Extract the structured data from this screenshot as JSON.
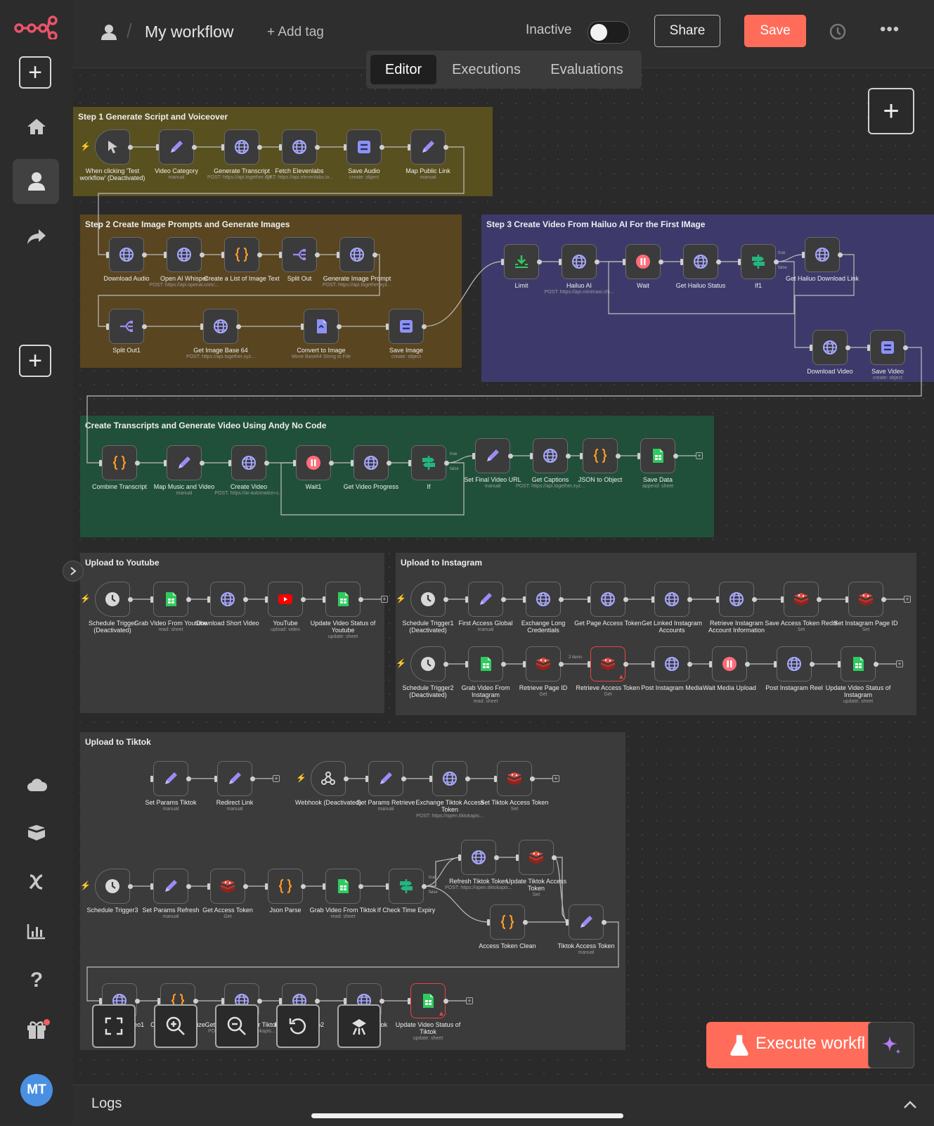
{
  "header": {
    "workflow_name": "My workflow",
    "add_tag_label": "+ Add tag",
    "status_label": "Inactive",
    "share_label": "Share",
    "save_label": "Save"
  },
  "tabs": [
    {
      "label": "Editor",
      "active": true
    },
    {
      "label": "Executions",
      "active": false
    },
    {
      "label": "Evaluations",
      "active": false
    }
  ],
  "sidebar": {
    "user_initials": "MT",
    "icons": [
      "logo-icon",
      "add-icon",
      "home-icon",
      "user-icon",
      "share-icon",
      "add-icon",
      "cloud-icon",
      "templates-icon",
      "variables-icon",
      "insights-icon",
      "help-icon",
      "gift-icon"
    ]
  },
  "stickies": [
    {
      "title": "Step 1 Generate Script and Voiceover"
    },
    {
      "title": "Step 2 Create Image Prompts and Generate Images"
    },
    {
      "title": "Step 3 Create Video From Hailuo AI For the First IMage"
    },
    {
      "title": "Create Transcripts and Generate Video Using Andy No Code"
    },
    {
      "title": "Upload to Youtube"
    },
    {
      "title": "Upload to Instagram"
    },
    {
      "title": "Upload to Tiktok"
    }
  ],
  "nodes": [
    {
      "label": "When clicking 'Test workflow' (Deactivated)",
      "sub": "",
      "icon": "cursor-icon"
    },
    {
      "label": "Video Category",
      "sub": "manual",
      "icon": "pencil-icon"
    },
    {
      "label": "Generate Transcript",
      "sub": "POST: https://api.together.xyz...",
      "icon": "globe-icon"
    },
    {
      "label": "Fetch Elevenlabs",
      "sub": "GET: https://api.elevenlabs.io...",
      "icon": "globe-icon"
    },
    {
      "label": "Save Audio",
      "sub": "create: object",
      "icon": "storage-icon"
    },
    {
      "label": "Map Public Link",
      "sub": "manual",
      "icon": "pencil-icon"
    },
    {
      "label": "Download Audio",
      "sub": "",
      "icon": "globe-icon"
    },
    {
      "label": "Open AI Whisper",
      "sub": "POST: https://api.openai.com/...",
      "icon": "globe-icon"
    },
    {
      "label": "Create a List of Image Text",
      "sub": "",
      "icon": "code-icon"
    },
    {
      "label": "Split Out",
      "sub": "",
      "icon": "split-icon"
    },
    {
      "label": "Generate Image Prompt",
      "sub": "POST: https://api.together.xyz...",
      "icon": "globe-icon"
    },
    {
      "label": "Split Out1",
      "sub": "",
      "icon": "split-icon"
    },
    {
      "label": "Get Image Base 64",
      "sub": "POST: https://api.together.xyz...",
      "icon": "globe-icon"
    },
    {
      "label": "Convert to Image",
      "sub": "Move Base64 String to File",
      "icon": "file-icon"
    },
    {
      "label": "Save Image",
      "sub": "create: object",
      "icon": "storage-icon"
    },
    {
      "label": "Limit",
      "sub": "",
      "icon": "limit-icon"
    },
    {
      "label": "Hailuo AI",
      "sub": "POST: https://api.minimaxi.chi...",
      "icon": "globe-icon"
    },
    {
      "label": "Wait",
      "sub": "",
      "icon": "wait-icon"
    },
    {
      "label": "Get Hailuo Status",
      "sub": "",
      "icon": "globe-icon"
    },
    {
      "label": "If1",
      "sub": "",
      "icon": "if-icon"
    },
    {
      "label": "Get Hailuo Download Link",
      "sub": "",
      "icon": "globe-icon"
    },
    {
      "label": "Download Video",
      "sub": "",
      "icon": "globe-icon"
    },
    {
      "label": "Save Video",
      "sub": "create: object",
      "icon": "storage-icon"
    },
    {
      "label": "Combine Transcript",
      "sub": "",
      "icon": "code-icon"
    },
    {
      "label": "Map Music and Video",
      "sub": "manual",
      "icon": "pencil-icon"
    },
    {
      "label": "Create Video",
      "sub": "POST: https://ai-automation-c...",
      "icon": "globe-icon"
    },
    {
      "label": "Wait1",
      "sub": "",
      "icon": "wait-icon"
    },
    {
      "label": "Get Video Progress",
      "sub": "",
      "icon": "globe-icon"
    },
    {
      "label": "If",
      "sub": "",
      "icon": "if-icon"
    },
    {
      "label": "Set Final Video URL",
      "sub": "manual",
      "icon": "pencil-icon"
    },
    {
      "label": "Get Captions",
      "sub": "POST: https://api.together.xyz...",
      "icon": "globe-icon"
    },
    {
      "label": "JSON to Object",
      "sub": "",
      "icon": "code-icon"
    },
    {
      "label": "Save Data",
      "sub": "append: sheet",
      "icon": "sheets-icon"
    },
    {
      "label": "Schedule Trigger (Deactivated)",
      "sub": "",
      "icon": "clock-icon"
    },
    {
      "label": "Grab Video From Youtube",
      "sub": "read: sheet",
      "icon": "sheets-icon"
    },
    {
      "label": "Download Short Video",
      "sub": "",
      "icon": "globe-icon"
    },
    {
      "label": "YouTube",
      "sub": "upload: video",
      "icon": "youtube-icon"
    },
    {
      "label": "Update Video Status of Youtube",
      "sub": "update: sheet",
      "icon": "sheets-icon"
    },
    {
      "label": "Schedule Trigger1 (Deactivated)",
      "sub": "",
      "icon": "clock-icon"
    },
    {
      "label": "First Access Global",
      "sub": "manual",
      "icon": "pencil-icon"
    },
    {
      "label": "Exchange Long Credentials",
      "sub": "",
      "icon": "globe-icon"
    },
    {
      "label": "Get Page Access Token",
      "sub": "",
      "icon": "globe-icon"
    },
    {
      "label": "Get Linked Instagram Accounts",
      "sub": "",
      "icon": "globe-icon"
    },
    {
      "label": "Retrieve Instagram Account Information",
      "sub": "",
      "icon": "globe-icon"
    },
    {
      "label": "Save Access Token Redis",
      "sub": "Set",
      "icon": "redis-icon"
    },
    {
      "label": "Set Instagram Page ID",
      "sub": "Set",
      "icon": "redis-icon"
    },
    {
      "label": "Schedule Trigger2 (Deactivated)",
      "sub": "",
      "icon": "clock-icon"
    },
    {
      "label": "Grab Video From Instagram",
      "sub": "read: sheet",
      "icon": "sheets-icon"
    },
    {
      "label": "Retrieve Page ID",
      "sub": "Get",
      "icon": "redis-icon"
    },
    {
      "label": "Retrieve Access Token",
      "sub": "Get",
      "icon": "redis-icon"
    },
    {
      "label": "Post Instagram Media",
      "sub": "",
      "icon": "globe-icon"
    },
    {
      "label": "Wait Media Upload",
      "sub": "",
      "icon": "wait-icon"
    },
    {
      "label": "Post Instagram Reel",
      "sub": "",
      "icon": "globe-icon"
    },
    {
      "label": "Update Video Status of Instagram",
      "sub": "update: sheet",
      "icon": "sheets-icon"
    },
    {
      "label": "Set Params Tiktok",
      "sub": "manual",
      "icon": "pencil-icon"
    },
    {
      "label": "Redirect Link",
      "sub": "manual",
      "icon": "pencil-icon"
    },
    {
      "label": "Webhook (Deactivated)",
      "sub": "",
      "icon": "webhook-icon"
    },
    {
      "label": "Set Params Retrieve",
      "sub": "manual",
      "icon": "pencil-icon"
    },
    {
      "label": "Exchange Tiktok Access Token",
      "sub": "POST: https://open.tiktokapis...",
      "icon": "globe-icon"
    },
    {
      "label": "Set Tiktok Access Token",
      "sub": "Set",
      "icon": "redis-icon"
    },
    {
      "label": "Schedule Trigger3",
      "sub": "",
      "icon": "clock-icon"
    },
    {
      "label": "Set Params Refresh",
      "sub": "manual",
      "icon": "pencil-icon"
    },
    {
      "label": "Get Access Token",
      "sub": "Get",
      "icon": "redis-icon"
    },
    {
      "label": "Json Parse",
      "sub": "",
      "icon": "code-icon"
    },
    {
      "label": "Grab Video From Tiktok",
      "sub": "read: sheet",
      "icon": "sheets-icon"
    },
    {
      "label": "If Check Time Expiry",
      "sub": "",
      "icon": "if-icon"
    },
    {
      "label": "Refresh Tiktok Token",
      "sub": "POST: https://open.tiktokapis...",
      "icon": "globe-icon"
    },
    {
      "label": "Update Tiktok Access Token",
      "sub": "Set",
      "icon": "redis-icon"
    },
    {
      "label": "Access Token Clean",
      "sub": "",
      "icon": "code-icon"
    },
    {
      "label": "Tiktok Access Token",
      "sub": "manual",
      "icon": "pencil-icon"
    },
    {
      "label": "Download Video1",
      "sub": "",
      "icon": "globe-icon"
    },
    {
      "label": "Convert Buffer Size",
      "sub": "",
      "icon": "code-icon"
    },
    {
      "label": "Get Upload URL for Tiktok",
      "sub": "POST: https://open.tiktokapis...",
      "icon": "globe-icon"
    },
    {
      "label": "Download Video2",
      "sub": "",
      "icon": "globe-icon"
    },
    {
      "label": "Upload To Tiktok",
      "sub": "",
      "icon": "globe-icon"
    },
    {
      "label": "Update Video Status of Tiktok",
      "sub": "update: sheet",
      "icon": "sheets-icon"
    }
  ],
  "edge_labels": {
    "true": "true",
    "false": "false",
    "items": "2 items"
  },
  "canvas_controls": [
    "fit-view-icon",
    "zoom-in-icon",
    "zoom-out-icon",
    "reset-zoom-icon",
    "tidy-up-icon"
  ],
  "execute_label": "Execute workfl",
  "logs_label": "Logs",
  "colors": {
    "accent": "#ff6d5a",
    "save": "#ff6d5a",
    "globe": "#a8a8ff",
    "code": "#ff9b26",
    "sheets": "#2ecc5f",
    "redis": "#d42e2e",
    "wait": "#ff6d7a",
    "if": "#24b47e"
  }
}
